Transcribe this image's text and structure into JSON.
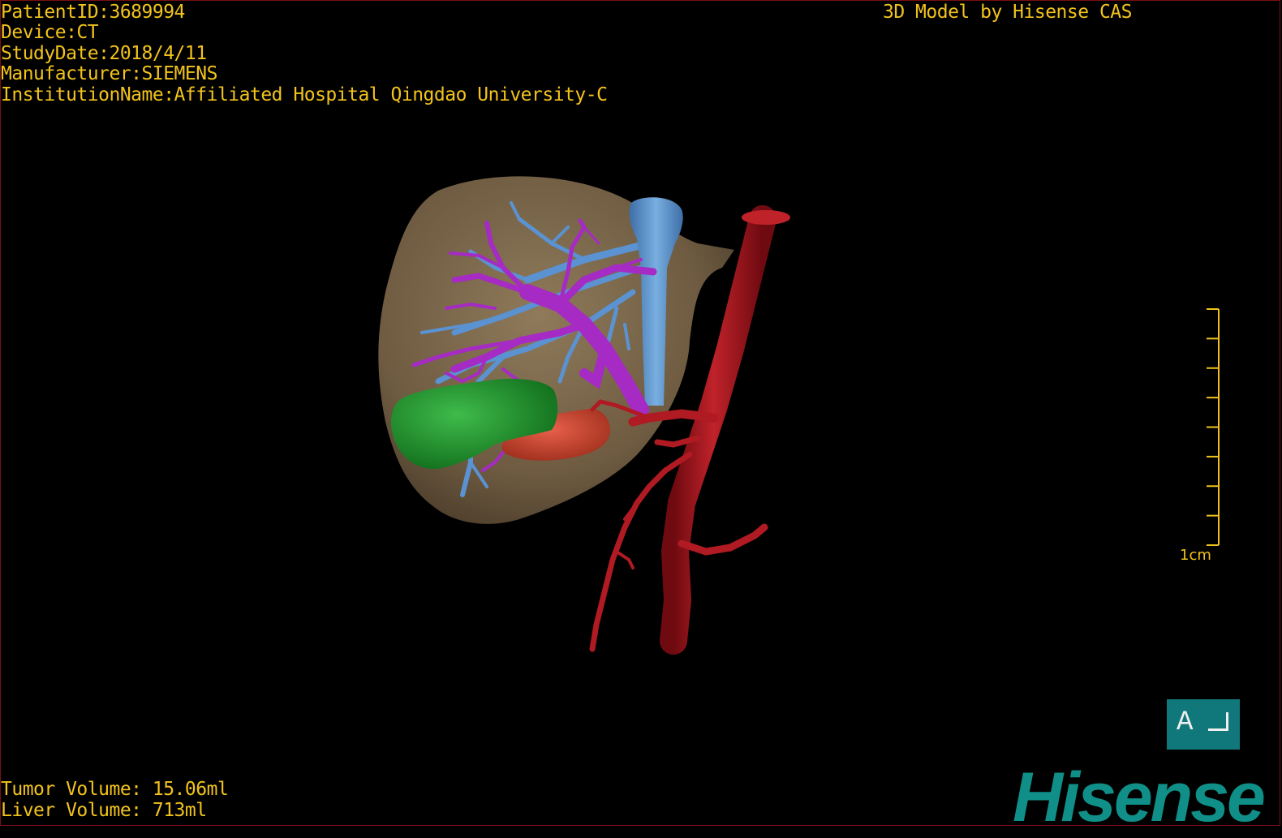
{
  "header": {
    "patient_id": "PatientID:3689994",
    "device": "Device:CT",
    "study_date": "StudyDate:2018/4/11",
    "manufacturer": "Manufacturer:SIEMENS",
    "institution": "InstitutionName:Affiliated Hospital Qingdao University-C",
    "model_credit": "3D Model by Hisense CAS"
  },
  "footer": {
    "tumor_volume": "Tumor Volume: 15.06ml",
    "liver_volume": "Liver Volume: 713ml"
  },
  "scale_bar": {
    "label": "1cm",
    "ticks": 9
  },
  "orientation": {
    "letter": "A",
    "icon": "orientation-corner-icon"
  },
  "brand": {
    "name": "Hisense",
    "color": "#0f8f88"
  },
  "colors": {
    "text": "#f2c31c",
    "liver": "#7a6548",
    "portal_vein": "#9a24b8",
    "hepatic_vein": "#4a86c8",
    "artery": "#a8141c",
    "tumor": "#1f8f2c",
    "gallbladder": "#c8452c"
  }
}
